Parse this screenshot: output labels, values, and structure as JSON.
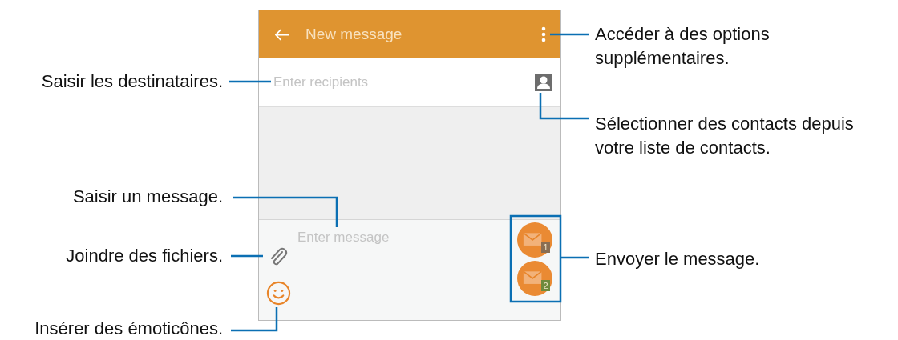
{
  "header": {
    "title": "New message"
  },
  "recipients": {
    "placeholder": "Enter recipients"
  },
  "compose": {
    "placeholder": "Enter message"
  },
  "send_buttons": [
    {
      "sim": "1",
      "color": "#8a6e52"
    },
    {
      "sim": "2",
      "color": "#6e8a3c"
    }
  ],
  "callouts": [
    "Accéder à des options\nsupplémentaires.",
    "Saisir les destinataires.",
    "Sélectionner des contacts depuis\nvotre liste de contacts.",
    "Saisir un message.",
    "Joindre des fichiers.",
    "Envoyer le message.",
    "Insérer des émoticônes."
  ]
}
